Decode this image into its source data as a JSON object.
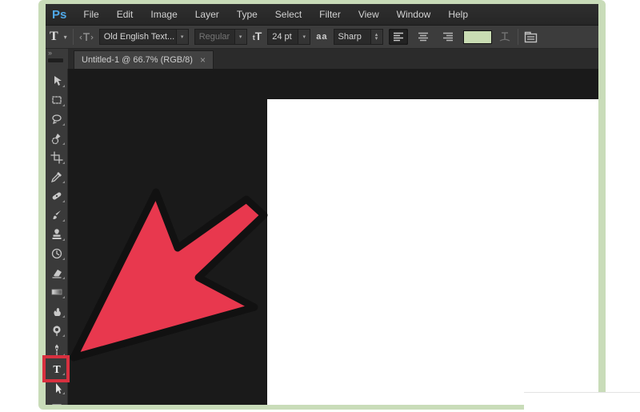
{
  "menubar": {
    "logo": "Ps",
    "items": [
      "File",
      "Edit",
      "Image",
      "Layer",
      "Type",
      "Select",
      "Filter",
      "View",
      "Window",
      "Help"
    ]
  },
  "options_bar": {
    "tool_preset_glyph": "T",
    "caret_down": "▾",
    "caret_up": "▴",
    "font_family": "Old English Text...",
    "font_style": "Regular",
    "size_icon_small": "t",
    "size_icon_large": "T",
    "font_size": "24 pt",
    "anti_alias_icon": "aa",
    "anti_alias": "Sharp",
    "alignment_selected": "align-left",
    "text_color_swatch": "#c9dcb3"
  },
  "document_tab": {
    "title": "Untitled-1 @ 66.7% (RGB/8)",
    "close": "×"
  },
  "toolbar": {
    "collapse": "»",
    "type_glyph": "T",
    "selected_tool": "type-tool",
    "tools": [
      "move-tool",
      "rectangular-marquee-tool",
      "lasso-tool",
      "quick-selection-tool",
      "crop-tool",
      "eyedropper-tool",
      "spot-healing-brush-tool",
      "brush-tool",
      "clone-stamp-tool",
      "history-brush-tool",
      "eraser-tool",
      "gradient-tool",
      "smudge-tool",
      "dodge-tool",
      "pen-tool",
      "type-tool",
      "path-selection-tool",
      "rectangle-tool"
    ]
  },
  "annotations": {
    "arrow_color": "#e8384e",
    "arrow_outline": "#111111",
    "highlight_color": "#d8303f"
  },
  "frame": {
    "color": "#c9dcb9"
  }
}
